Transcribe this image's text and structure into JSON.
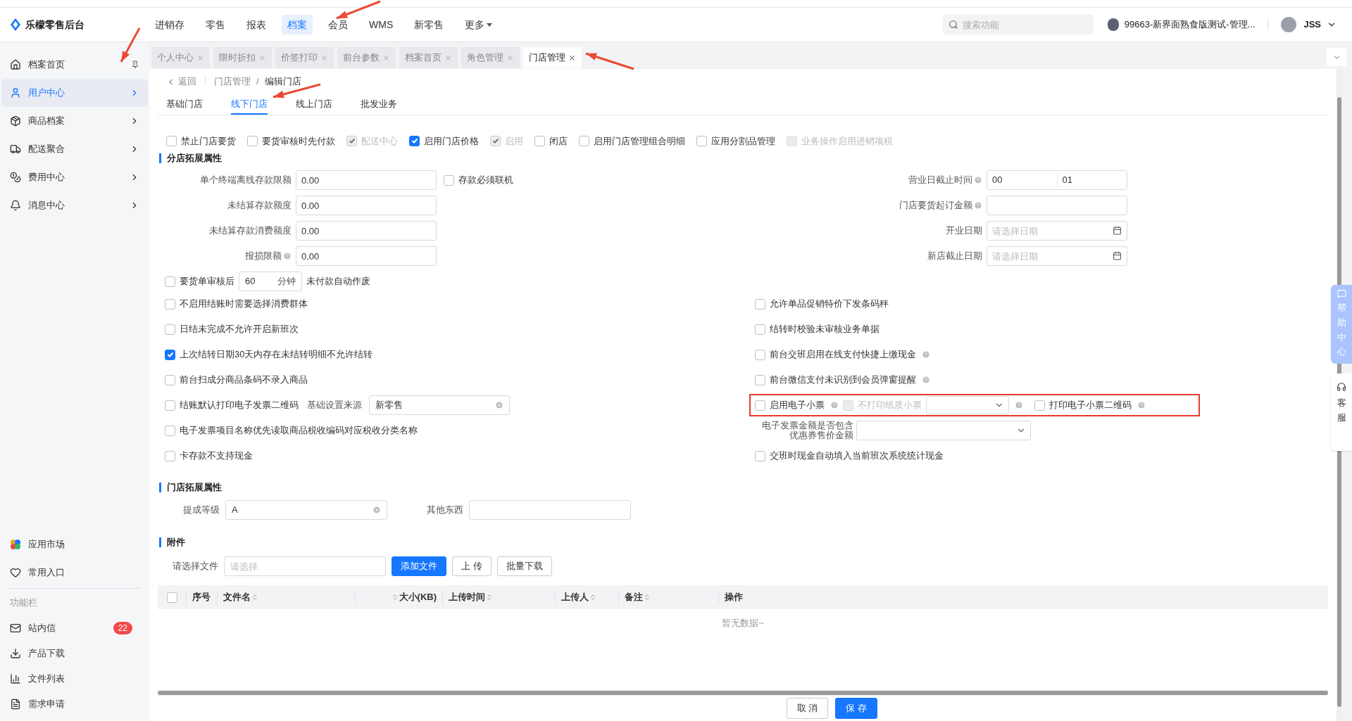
{
  "app": {
    "name": "乐檬零售后台"
  },
  "top_nav": [
    {
      "label": "进销存",
      "selected": false
    },
    {
      "label": "零售",
      "selected": false
    },
    {
      "label": "报表",
      "selected": false
    },
    {
      "label": "档案",
      "selected": true
    },
    {
      "label": "会员",
      "selected": false
    },
    {
      "label": "WMS",
      "selected": false
    },
    {
      "label": "新零售",
      "selected": false
    },
    {
      "label": "更多",
      "selected": false,
      "kind": "dropdown"
    }
  ],
  "search": {
    "placeholder": "搜索功能"
  },
  "store": "99663-新界面熟食版测试-管理...",
  "user": "JSS",
  "sidebar": {
    "items": [
      {
        "label": "档案首页",
        "selected": false,
        "kind": "home"
      },
      {
        "label": "用户中心",
        "selected": true,
        "kind": "user"
      },
      {
        "label": "商品档案",
        "selected": false,
        "kind": "goods"
      },
      {
        "label": "配送聚合",
        "selected": false,
        "kind": "delivery"
      },
      {
        "label": "费用中心",
        "selected": false,
        "kind": "fee"
      },
      {
        "label": "消息中心",
        "selected": false,
        "kind": "message"
      }
    ],
    "bottom_items": [
      {
        "label": "应用市场",
        "kind": "market"
      },
      {
        "label": "常用入口",
        "kind": "heart"
      }
    ],
    "function_bar": {
      "title": "功能栏",
      "items": [
        {
          "label": "站内信",
          "kind": "mail",
          "badge": "22"
        },
        {
          "label": "产品下载",
          "kind": "download"
        },
        {
          "label": "文件列表",
          "kind": "chart"
        },
        {
          "label": "需求申请",
          "kind": "form"
        }
      ]
    }
  },
  "open_tabs": [
    {
      "label": "个人中心",
      "selected": false
    },
    {
      "label": "限时折扣",
      "selected": false
    },
    {
      "label": "价签打印",
      "selected": false
    },
    {
      "label": "前台参数",
      "selected": false
    },
    {
      "label": "档案首页",
      "selected": false
    },
    {
      "label": "角色管理",
      "selected": false
    },
    {
      "label": "门店管理",
      "selected": true
    }
  ],
  "breadcrumb": {
    "back": "返回",
    "separator": "/",
    "path": [
      "门店管理",
      "编辑门店"
    ]
  },
  "sub_tabs": [
    {
      "label": "基础门店",
      "selected": false
    },
    {
      "label": "线下门店",
      "selected": true
    },
    {
      "label": "线上门店",
      "selected": false
    },
    {
      "label": "批发业务",
      "selected": false
    }
  ],
  "options": [
    {
      "label": "禁止门店要货",
      "checked": false,
      "disabled": false
    },
    {
      "label": "要货审核时先付款",
      "checked": false,
      "disabled": false
    },
    {
      "label": "配送中心",
      "checked": true,
      "disabled": true
    },
    {
      "label": "启用门店价格",
      "checked": true,
      "disabled": false
    },
    {
      "label": "启用",
      "checked": true,
      "disabled": true
    },
    {
      "label": "闭店",
      "checked": false,
      "disabled": false
    },
    {
      "label": "启用门店管理组合明细",
      "checked": false,
      "disabled": false
    },
    {
      "label": "应用分割品管理",
      "checked": false,
      "disabled": false
    },
    {
      "label": "业务操作启用进销项税",
      "checked": false,
      "disabled": true
    }
  ],
  "branch_section": {
    "title": "分店拓展属性",
    "left_fields": [
      {
        "label": "单个终端离线存款限额",
        "value": "0.00",
        "help": false,
        "extra": {
          "label": "存款必须联机",
          "checked": false
        }
      },
      {
        "label": "未结算存款额度",
        "value": "0.00",
        "help": false
      },
      {
        "label": "未结算存款消费额度",
        "value": "0.00",
        "help": false
      },
      {
        "label": "报损限额",
        "value": "0.00",
        "help": true
      }
    ],
    "right_fields": [
      {
        "label": "营业日截止时间",
        "help": true,
        "kind": "time",
        "values": [
          "00",
          "01"
        ]
      },
      {
        "label": "门店要货起订金额",
        "help": true,
        "kind": "text"
      },
      {
        "label": "开业日期",
        "help": false,
        "kind": "date",
        "placeholder": "请选择日期"
      },
      {
        "label": "新店截止日期",
        "help": false,
        "kind": "date",
        "placeholder": "请选择日期"
      }
    ],
    "order_void": {
      "checked": false,
      "before": "要货单审核后",
      "value": "60",
      "unit": "分钟",
      "after": "未付款自动作废"
    },
    "left_checks": [
      {
        "kind": "plain",
        "label": "不启用结账时需要选择消费群体",
        "checked": false
      },
      {
        "kind": "plain",
        "label": "日结未完成不允许开启新班次",
        "checked": false
      },
      {
        "kind": "plain",
        "label": "上次结转日期30天内存在未结转明细不允许结转",
        "checked": true
      },
      {
        "kind": "plain",
        "label": "前台扫成分商品条码不录入商品",
        "checked": false
      },
      {
        "kind": "source",
        "label": "结账默认打印电子发票二维码",
        "checked": false,
        "source_label": "基础设置来源",
        "source_value": "新零售"
      },
      {
        "kind": "plain",
        "label": "电子发票项目名称优先读取商品税收编码对应税收分类名称",
        "checked": false
      },
      {
        "kind": "plain",
        "label": "卡存款不支持现金",
        "checked": false
      }
    ],
    "right_checks": [
      {
        "kind": "plain",
        "label": "允许单品促销特价下发条码秤",
        "checked": false,
        "help": false
      },
      {
        "kind": "plain",
        "label": "结转时校验未审核业务单据",
        "checked": false,
        "help": false
      },
      {
        "kind": "plain",
        "label": "前台交班启用在线支付快捷上缴现金",
        "checked": false,
        "help": true
      },
      {
        "kind": "plain",
        "label": "前台微信支付未识别到会员弹窗提醒",
        "checked": false,
        "help": true
      },
      {
        "kind": "receipt",
        "label": "启用电子小票",
        "checked": false,
        "help": true,
        "highlighted": true,
        "paper": {
          "label": "不打印纸质小票",
          "checked": false,
          "disabled": true
        },
        "qr": {
          "label": "打印电子小票二维码",
          "checked": false,
          "help": true
        }
      },
      {
        "kind": "select",
        "label_lines": [
          "电子发票金额是否包含",
          "优惠券售价金额"
        ]
      },
      {
        "kind": "plain",
        "label": "交班时现金自动填入当前班次系统统计现金",
        "checked": false,
        "help": false
      }
    ]
  },
  "store_section": {
    "title": "门店拓展属性",
    "fields": [
      {
        "label": "提成等级",
        "value": "A",
        "clearable": true
      },
      {
        "label": "其他东西",
        "clearable": false
      }
    ]
  },
  "attachments": {
    "title": "附件",
    "file_label": "请选择文件",
    "placeholder": "请选择",
    "buttons": [
      {
        "label": "添加文件",
        "primary": true
      },
      {
        "label": "上 传",
        "primary": false
      },
      {
        "label": "批量下载",
        "primary": false
      }
    ],
    "columns": [
      {
        "label": "序号",
        "kind": "plain"
      },
      {
        "label": "文件名",
        "kind": "sort"
      },
      {
        "label": "大小(KB)",
        "kind": "numeric"
      },
      {
        "label": "上传时间",
        "kind": "sort"
      },
      {
        "label": "上传人",
        "kind": "sort"
      },
      {
        "label": "备注",
        "kind": "sort"
      },
      {
        "label": "操作",
        "kind": "plain"
      }
    ],
    "select_all": {
      "checked": false
    },
    "empty": "暂无数据~"
  },
  "footer_buttons": [
    {
      "label": "取 消",
      "primary": false
    },
    {
      "label": "保 存",
      "primary": true
    }
  ],
  "help_panel": {
    "label": "帮助中心"
  },
  "service_panel": {
    "label": "客服"
  }
}
